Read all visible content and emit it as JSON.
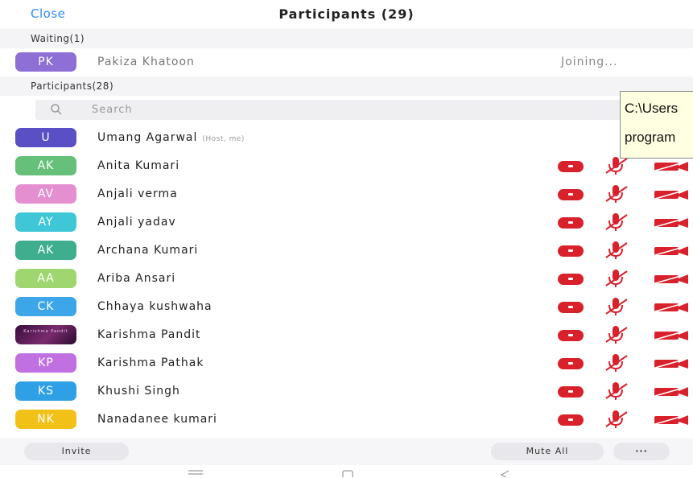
{
  "header": {
    "close_label": "Close",
    "title": "Participants (29)"
  },
  "waiting": {
    "section_label": "Waiting(1)",
    "items": [
      {
        "initials": "PK",
        "name": "Pakiza Khatoon",
        "status": "Joining...",
        "color": "#8e6fd6"
      }
    ]
  },
  "participants": {
    "section_label": "Participants(28)",
    "search_placeholder": "Search",
    "host": {
      "initials": "U",
      "name": "Umang Agarwal",
      "role": "(Host, me)",
      "color": "#5b4fc6"
    },
    "items": [
      {
        "initials": "AK",
        "name": "Anita Kumari",
        "color": "#66c07a"
      },
      {
        "initials": "AV",
        "name": "Anjali verma",
        "color": "#e48fd0"
      },
      {
        "initials": "AY",
        "name": "Anjali yadav",
        "color": "#3fc7d8"
      },
      {
        "initials": "AK",
        "name": "Archana Kumari",
        "color": "#3fae8e"
      },
      {
        "initials": "AA",
        "name": "Ariba Ansari",
        "color": "#9fd66f"
      },
      {
        "initials": "CK",
        "name": "Chhaya kushwaha",
        "color": "#3ca6e8"
      },
      {
        "initials": "",
        "name": "Karishma Pandit",
        "color": "#4a1746",
        "photo": true,
        "photo_text": "Karishma Pandit"
      },
      {
        "initials": "KP",
        "name": "Karishma Pathak",
        "color": "#c070e0"
      },
      {
        "initials": "KS",
        "name": "Khushi Singh",
        "color": "#2f9fe6"
      },
      {
        "initials": "NK",
        "name": "Nanadanee kumari",
        "color": "#f2c118"
      }
    ]
  },
  "tooltip": {
    "line1": "C:\\Users",
    "line2": "program"
  },
  "footer": {
    "invite_label": "Invite",
    "mute_all_label": "Mute All",
    "more_label": "···"
  },
  "colors": {
    "accent": "#2d8cff",
    "alert_red": "#d9212c"
  }
}
